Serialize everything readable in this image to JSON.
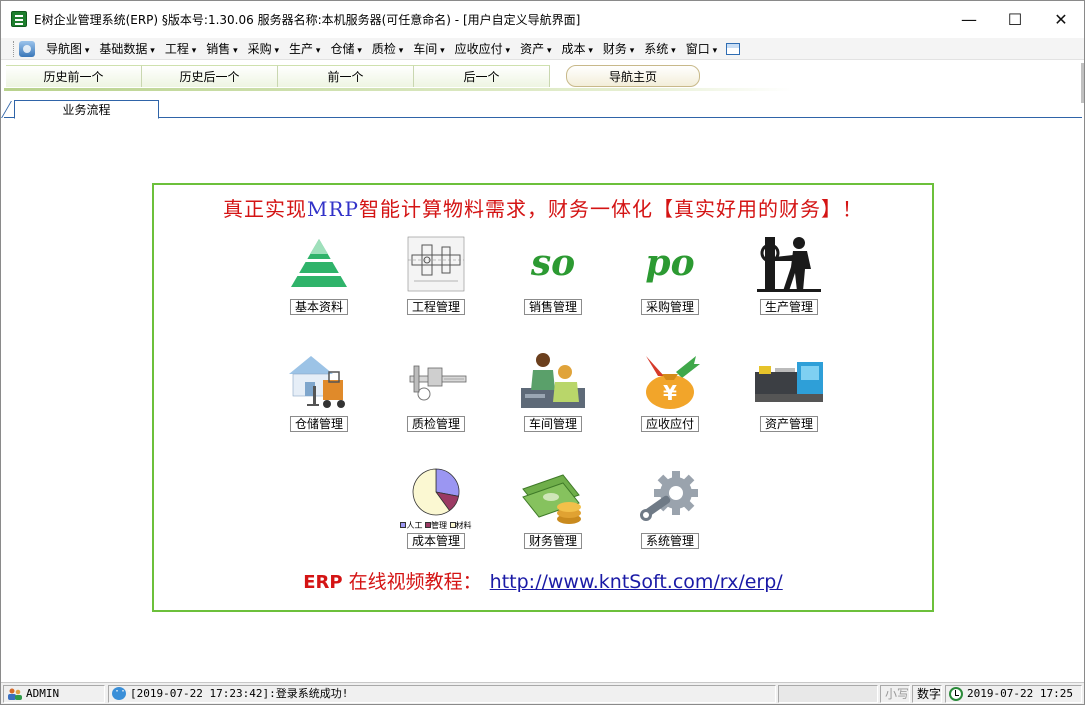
{
  "window": {
    "title": "E树企业管理系统(ERP) §版本号:1.30.06  服务器名称:本机服务器(可任意命名) - [用户自定义导航界面]",
    "minimize": "—",
    "maximize": "☐",
    "close": "✕"
  },
  "menu": {
    "items": [
      "导航图",
      "基础数据",
      "工程",
      "销售",
      "采购",
      "生产",
      "仓储",
      "质检",
      "车间",
      "应收应付",
      "资产",
      "成本",
      "财务",
      "系统",
      "窗口"
    ]
  },
  "nav": {
    "history_prev": "历史前一个",
    "history_next": "历史后一个",
    "prev": "前一个",
    "next": "后一个",
    "home": "导航主页"
  },
  "tabs": {
    "business_flow": "业务流程"
  },
  "panel": {
    "headline_pre": "真正实现",
    "headline_mrp": "MRP",
    "headline_post": "智能计算物料需求，财务一体化【真实好用的财务】！",
    "modules": {
      "basic": "基本资料",
      "engineering": "工程管理",
      "sales": "销售管理",
      "purchase": "采购管理",
      "production": "生产管理",
      "warehouse": "仓储管理",
      "quality": "质检管理",
      "workshop": "车间管理",
      "receivable": "应收应付",
      "assets": "资产管理",
      "cost": "成本管理",
      "finance": "财务管理",
      "system": "系统管理"
    },
    "sales_icon_text": "so",
    "purchase_icon_text": "po",
    "cost_legend": [
      "人工",
      "管理",
      "材料"
    ],
    "cost_pie": [
      {
        "name": "人工",
        "value": 28,
        "color": "#9b96f2"
      },
      {
        "name": "管理",
        "value": 12,
        "color": "#9b3a63"
      },
      {
        "name": "材料",
        "value": 60,
        "color": "#fbf8d2"
      }
    ],
    "receivable_icon_text": "¥",
    "tutorial_erp": "ERP",
    "tutorial_text": " 在线视频教程：",
    "tutorial_url": "http://www.kntSoft.com/rx/erp/"
  },
  "status": {
    "user": "ADMIN",
    "message": "[2019-07-22 17:23:42]:登录系统成功!",
    "caps": "小写",
    "num": "数字",
    "clock": "2019-07-22 17:25"
  },
  "colors": {
    "panel_border": "#6cc03b",
    "headline": "#d41414",
    "mrp": "#3232c8",
    "link": "#1a1aa6",
    "tab_border": "#2f64a8"
  }
}
